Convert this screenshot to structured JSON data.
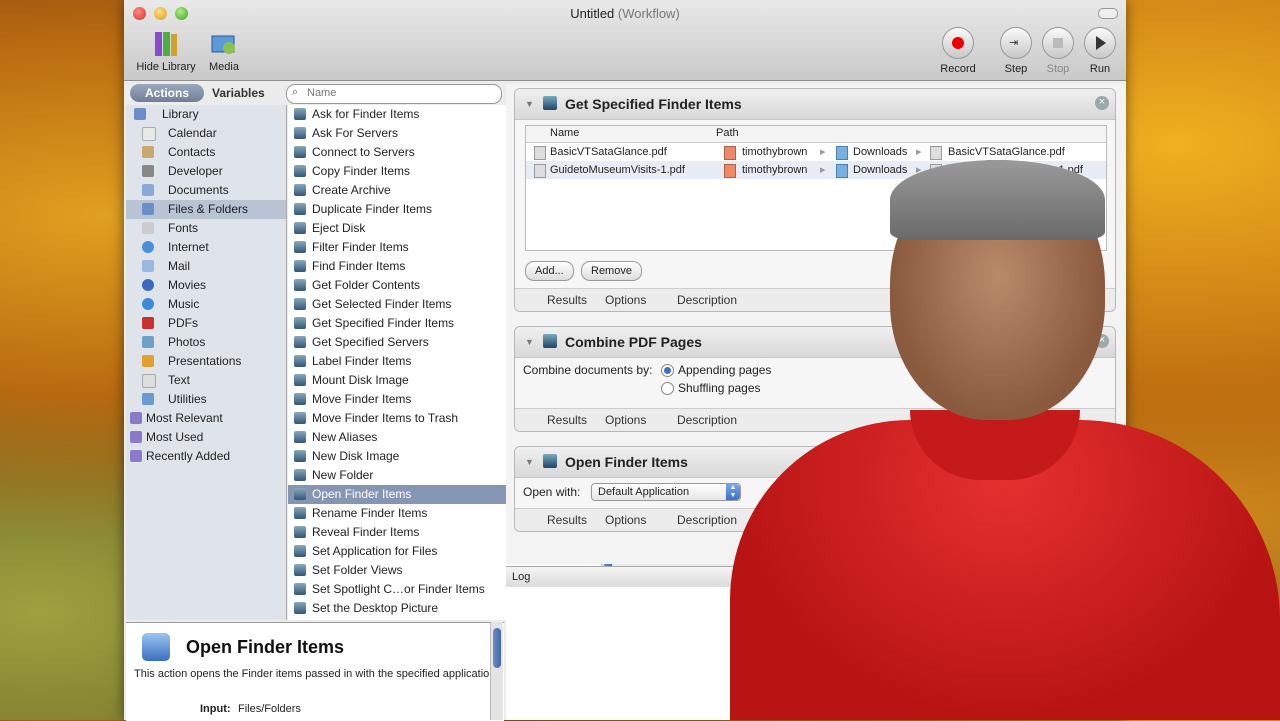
{
  "window": {
    "title": "Untitled",
    "subtitle": "(Workflow)"
  },
  "toolbar": {
    "hide_library": "Hide Library",
    "media": "Media",
    "record": "Record",
    "step": "Step",
    "stop": "Stop",
    "run": "Run"
  },
  "library": {
    "tab_actions": "Actions",
    "tab_variables": "Variables",
    "search_placeholder": "Name",
    "categories": [
      {
        "label": "Library",
        "color": "#6a8fc8"
      },
      {
        "label": "Calendar",
        "color": "#e8e8e8"
      },
      {
        "label": "Contacts",
        "color": "#c8a870"
      },
      {
        "label": "Developer",
        "color": "#888888"
      },
      {
        "label": "Documents",
        "color": "#8aa8d8"
      },
      {
        "label": "Files & Folders",
        "color": "#6a8fc8"
      },
      {
        "label": "Fonts",
        "color": "#cccccc"
      },
      {
        "label": "Internet",
        "color": "#4a90d8"
      },
      {
        "label": "Mail",
        "color": "#9ab8e0"
      },
      {
        "label": "Movies",
        "color": "#3a6ac0"
      },
      {
        "label": "Music",
        "color": "#3a8ad8"
      },
      {
        "label": "PDFs",
        "color": "#c83030"
      },
      {
        "label": "Photos",
        "color": "#70a0c8"
      },
      {
        "label": "Presentations",
        "color": "#e0a030"
      },
      {
        "label": "Text",
        "color": "#dddddd"
      },
      {
        "label": "Utilities",
        "color": "#6a9ad0"
      },
      {
        "label": "Most Relevant",
        "color": "#8a7ac8"
      },
      {
        "label": "Most Used",
        "color": "#8a7ac8"
      },
      {
        "label": "Recently Added",
        "color": "#8a7ac8"
      }
    ],
    "actions": [
      "Ask for Finder Items",
      "Ask For Servers",
      "Connect to Servers",
      "Copy Finder Items",
      "Create Archive",
      "Duplicate Finder Items",
      "Eject Disk",
      "Filter Finder Items",
      "Find Finder Items",
      "Get Folder Contents",
      "Get Selected Finder Items",
      "Get Specified Finder Items",
      "Get Specified Servers",
      "Label Finder Items",
      "Mount Disk Image",
      "Move Finder Items",
      "Move Finder Items to Trash",
      "New Aliases",
      "New Disk Image",
      "New Folder",
      "Open Finder Items",
      "Rename Finder Items",
      "Reveal Finder Items",
      "Set Application for Files",
      "Set Folder Views",
      "Set Spotlight C…or Finder Items",
      "Set the Desktop Picture"
    ],
    "selected_action": "Open Finder Items"
  },
  "description": {
    "title": "Open Finder Items",
    "text": "This action opens the Finder items passed in with the specified application.",
    "input_label": "Input:",
    "input_value": "Files/Folders"
  },
  "workflow": {
    "action1": {
      "title": "Get Specified Finder Items",
      "col_name": "Name",
      "col_path": "Path",
      "files": [
        {
          "name": "BasicVTSataGlance.pdf",
          "user": "timothybrown",
          "folder": "Downloads",
          "file": "BasicVTSataGlance.pdf"
        },
        {
          "name": "GuidetoMuseumVisits-1.pdf",
          "user": "timothybrown",
          "folder": "Downloads",
          "file": "GuidetoMuseumVisits-1.pdf"
        }
      ],
      "add": "Add...",
      "remove": "Remove"
    },
    "action2": {
      "title": "Combine PDF Pages",
      "combine_label": "Combine documents by:",
      "opt_append": "Appending pages",
      "opt_shuffle": "Shuffling pages"
    },
    "action3": {
      "title": "Open Finder Items",
      "open_label": "Open with:",
      "open_value": "Default Application"
    },
    "footer": {
      "results": "Results",
      "options": "Options",
      "description": "Description"
    }
  },
  "log": {
    "label": "Log"
  }
}
